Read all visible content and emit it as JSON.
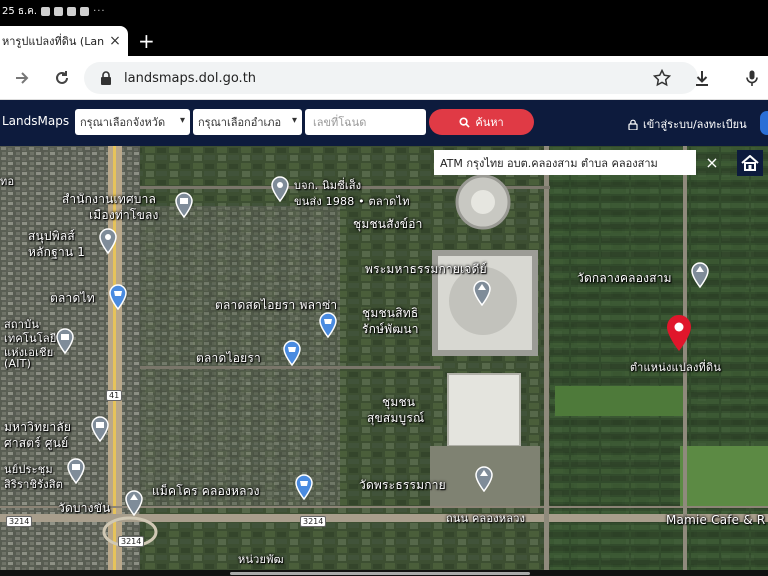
{
  "status_bar": {
    "time": "25 ธ.ค.",
    "more": "···"
  },
  "tab": {
    "title": "หารูปแปลงที่ดิน (Lan",
    "close": "×"
  },
  "new_tab": "+",
  "address": {
    "url": "landsmaps.dol.go.th"
  },
  "header": {
    "logo": "LandsMaps",
    "province_select": "กรุณาเลือกจังหวัด",
    "district_select": "กรุณาเลือกอำเภอ",
    "deed_placeholder": "เลขที่โฉนด",
    "search_label": "ค้นหา",
    "login_label": "เข้าสู่ระบบ/ลงทะเบียน"
  },
  "map": {
    "popup_text": "ATM กรุงไทย อบต.คลองสาม ตำบล คลองสาม",
    "popup_close": "×",
    "labels": [
      "สำนักงานเทศบาล",
      "เมืองท่าโขลง",
      "บจก. นิมซี่เส็ง",
      "ขนส่ง 1988 • ตลาดไท",
      "ชุมชนสังข์อ่า",
      "สนุปพิลส์",
      "หลักฐาน 1",
      "ตลาดไท",
      "พระมหาธรรมกายเจดีย์",
      "วัดกลางคลองสาม",
      "ตลาดสดไอยรา พลาซ่า",
      "ชุมชนสิทธิ",
      "รักษ์พัฒนา",
      "สถาบัน",
      "เทคโนโลยี",
      "แห่งเอเชีย",
      "(AIT)",
      "ตลาดไอยรา",
      "ตำแหน่งแปลงที่ดิน",
      "ชุมชน",
      "สุขสมบูรณ์",
      "มหาวิทยาลัย",
      "ศาสตร์ ศูนย์",
      "นย์ประชุม",
      "สิริราชิรังสิต",
      "วัดบางขัน",
      "แม็คโคร คลองหลวง",
      "วัดพระธรรมกาย",
      "Mamie Cafe & R",
      "ถนน คลองหลวง",
      "หน่วยพัฒ",
      "ทอ"
    ],
    "routes": [
      "41",
      "3214",
      "3214",
      "3214"
    ]
  },
  "colors": {
    "header_bg": "#0d1b3d",
    "search_btn": "#e03a45",
    "pin_red": "#e0162b",
    "poi_blue": "#4a8be0",
    "poi_grey": "#7f8c99"
  }
}
